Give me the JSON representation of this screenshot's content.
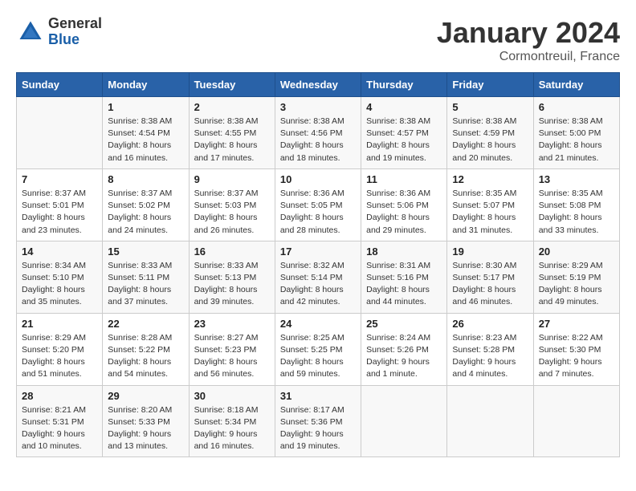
{
  "header": {
    "logo_general": "General",
    "logo_blue": "Blue",
    "month": "January 2024",
    "location": "Cormontreuil, France"
  },
  "columns": [
    "Sunday",
    "Monday",
    "Tuesday",
    "Wednesday",
    "Thursday",
    "Friday",
    "Saturday"
  ],
  "weeks": [
    [
      {
        "day": "",
        "sunrise": "",
        "sunset": "",
        "daylight": ""
      },
      {
        "day": "1",
        "sunrise": "Sunrise: 8:38 AM",
        "sunset": "Sunset: 4:54 PM",
        "daylight": "Daylight: 8 hours and 16 minutes."
      },
      {
        "day": "2",
        "sunrise": "Sunrise: 8:38 AM",
        "sunset": "Sunset: 4:55 PM",
        "daylight": "Daylight: 8 hours and 17 minutes."
      },
      {
        "day": "3",
        "sunrise": "Sunrise: 8:38 AM",
        "sunset": "Sunset: 4:56 PM",
        "daylight": "Daylight: 8 hours and 18 minutes."
      },
      {
        "day": "4",
        "sunrise": "Sunrise: 8:38 AM",
        "sunset": "Sunset: 4:57 PM",
        "daylight": "Daylight: 8 hours and 19 minutes."
      },
      {
        "day": "5",
        "sunrise": "Sunrise: 8:38 AM",
        "sunset": "Sunset: 4:59 PM",
        "daylight": "Daylight: 8 hours and 20 minutes."
      },
      {
        "day": "6",
        "sunrise": "Sunrise: 8:38 AM",
        "sunset": "Sunset: 5:00 PM",
        "daylight": "Daylight: 8 hours and 21 minutes."
      }
    ],
    [
      {
        "day": "7",
        "sunrise": "Sunrise: 8:37 AM",
        "sunset": "Sunset: 5:01 PM",
        "daylight": "Daylight: 8 hours and 23 minutes."
      },
      {
        "day": "8",
        "sunrise": "Sunrise: 8:37 AM",
        "sunset": "Sunset: 5:02 PM",
        "daylight": "Daylight: 8 hours and 24 minutes."
      },
      {
        "day": "9",
        "sunrise": "Sunrise: 8:37 AM",
        "sunset": "Sunset: 5:03 PM",
        "daylight": "Daylight: 8 hours and 26 minutes."
      },
      {
        "day": "10",
        "sunrise": "Sunrise: 8:36 AM",
        "sunset": "Sunset: 5:05 PM",
        "daylight": "Daylight: 8 hours and 28 minutes."
      },
      {
        "day": "11",
        "sunrise": "Sunrise: 8:36 AM",
        "sunset": "Sunset: 5:06 PM",
        "daylight": "Daylight: 8 hours and 29 minutes."
      },
      {
        "day": "12",
        "sunrise": "Sunrise: 8:35 AM",
        "sunset": "Sunset: 5:07 PM",
        "daylight": "Daylight: 8 hours and 31 minutes."
      },
      {
        "day": "13",
        "sunrise": "Sunrise: 8:35 AM",
        "sunset": "Sunset: 5:08 PM",
        "daylight": "Daylight: 8 hours and 33 minutes."
      }
    ],
    [
      {
        "day": "14",
        "sunrise": "Sunrise: 8:34 AM",
        "sunset": "Sunset: 5:10 PM",
        "daylight": "Daylight: 8 hours and 35 minutes."
      },
      {
        "day": "15",
        "sunrise": "Sunrise: 8:33 AM",
        "sunset": "Sunset: 5:11 PM",
        "daylight": "Daylight: 8 hours and 37 minutes."
      },
      {
        "day": "16",
        "sunrise": "Sunrise: 8:33 AM",
        "sunset": "Sunset: 5:13 PM",
        "daylight": "Daylight: 8 hours and 39 minutes."
      },
      {
        "day": "17",
        "sunrise": "Sunrise: 8:32 AM",
        "sunset": "Sunset: 5:14 PM",
        "daylight": "Daylight: 8 hours and 42 minutes."
      },
      {
        "day": "18",
        "sunrise": "Sunrise: 8:31 AM",
        "sunset": "Sunset: 5:16 PM",
        "daylight": "Daylight: 8 hours and 44 minutes."
      },
      {
        "day": "19",
        "sunrise": "Sunrise: 8:30 AM",
        "sunset": "Sunset: 5:17 PM",
        "daylight": "Daylight: 8 hours and 46 minutes."
      },
      {
        "day": "20",
        "sunrise": "Sunrise: 8:29 AM",
        "sunset": "Sunset: 5:19 PM",
        "daylight": "Daylight: 8 hours and 49 minutes."
      }
    ],
    [
      {
        "day": "21",
        "sunrise": "Sunrise: 8:29 AM",
        "sunset": "Sunset: 5:20 PM",
        "daylight": "Daylight: 8 hours and 51 minutes."
      },
      {
        "day": "22",
        "sunrise": "Sunrise: 8:28 AM",
        "sunset": "Sunset: 5:22 PM",
        "daylight": "Daylight: 8 hours and 54 minutes."
      },
      {
        "day": "23",
        "sunrise": "Sunrise: 8:27 AM",
        "sunset": "Sunset: 5:23 PM",
        "daylight": "Daylight: 8 hours and 56 minutes."
      },
      {
        "day": "24",
        "sunrise": "Sunrise: 8:25 AM",
        "sunset": "Sunset: 5:25 PM",
        "daylight": "Daylight: 8 hours and 59 minutes."
      },
      {
        "day": "25",
        "sunrise": "Sunrise: 8:24 AM",
        "sunset": "Sunset: 5:26 PM",
        "daylight": "Daylight: 9 hours and 1 minute."
      },
      {
        "day": "26",
        "sunrise": "Sunrise: 8:23 AM",
        "sunset": "Sunset: 5:28 PM",
        "daylight": "Daylight: 9 hours and 4 minutes."
      },
      {
        "day": "27",
        "sunrise": "Sunrise: 8:22 AM",
        "sunset": "Sunset: 5:30 PM",
        "daylight": "Daylight: 9 hours and 7 minutes."
      }
    ],
    [
      {
        "day": "28",
        "sunrise": "Sunrise: 8:21 AM",
        "sunset": "Sunset: 5:31 PM",
        "daylight": "Daylight: 9 hours and 10 minutes."
      },
      {
        "day": "29",
        "sunrise": "Sunrise: 8:20 AM",
        "sunset": "Sunset: 5:33 PM",
        "daylight": "Daylight: 9 hours and 13 minutes."
      },
      {
        "day": "30",
        "sunrise": "Sunrise: 8:18 AM",
        "sunset": "Sunset: 5:34 PM",
        "daylight": "Daylight: 9 hours and 16 minutes."
      },
      {
        "day": "31",
        "sunrise": "Sunrise: 8:17 AM",
        "sunset": "Sunset: 5:36 PM",
        "daylight": "Daylight: 9 hours and 19 minutes."
      },
      {
        "day": "",
        "sunrise": "",
        "sunset": "",
        "daylight": ""
      },
      {
        "day": "",
        "sunrise": "",
        "sunset": "",
        "daylight": ""
      },
      {
        "day": "",
        "sunrise": "",
        "sunset": "",
        "daylight": ""
      }
    ]
  ]
}
